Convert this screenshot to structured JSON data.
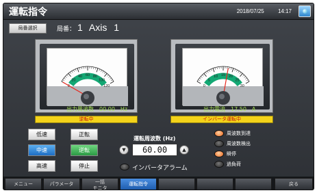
{
  "header": {
    "title": "運転指令",
    "date": "2018/07/25",
    "time": "14:17"
  },
  "axis": {
    "select_button": "局番選択",
    "label": "局番：",
    "number": "1",
    "name": "Axis 1"
  },
  "meters": [
    {
      "ticks": [
        "0",
        "20",
        "40",
        "60",
        "80",
        "100",
        "120"
      ],
      "max": 120,
      "value": 0,
      "readout_label": "出力周波数",
      "readout_value": "00.00",
      "readout_unit": "Hz",
      "status": "逆転中"
    },
    {
      "ticks": [
        "0",
        "5",
        "10",
        "15",
        "20",
        "25",
        "30"
      ],
      "max": 30,
      "value": 17.5,
      "readout_label": "出力電流",
      "readout_value": "17.50",
      "readout_unit": "A",
      "status": "インバータ運転中"
    }
  ],
  "speed_buttons": {
    "low": "低速",
    "mid": "中速",
    "high": "高速",
    "forward": "正転",
    "reverse": "逆転",
    "stop": "停止"
  },
  "frequency": {
    "label": "運転周波数 (Hz)",
    "value": "60.00",
    "down": "▼",
    "up": "▲"
  },
  "alarm": {
    "label": "インバータアラーム"
  },
  "indicators": [
    {
      "label": "周波数到達",
      "on": true
    },
    {
      "label": "周波数検出",
      "on": false
    },
    {
      "label": "瞬停",
      "on": true
    },
    {
      "label": "過負荷",
      "on": false
    }
  ],
  "footer": {
    "tabs": [
      {
        "label": "メニュー"
      },
      {
        "label": "パラメータ"
      },
      {
        "line1": "一括",
        "line2": "モニタ"
      },
      {
        "label": "運転指令"
      },
      {
        "label": ""
      },
      {
        "label": ""
      },
      {
        "label": ""
      },
      {
        "label": "戻る"
      }
    ]
  },
  "colors": {
    "green_band": "#13a874",
    "needle": "#e8281e",
    "readout": "#a7e05a",
    "status_bg": "#f4d31a",
    "status_text": "#c0170f",
    "active_tab": "#2f74c8"
  }
}
